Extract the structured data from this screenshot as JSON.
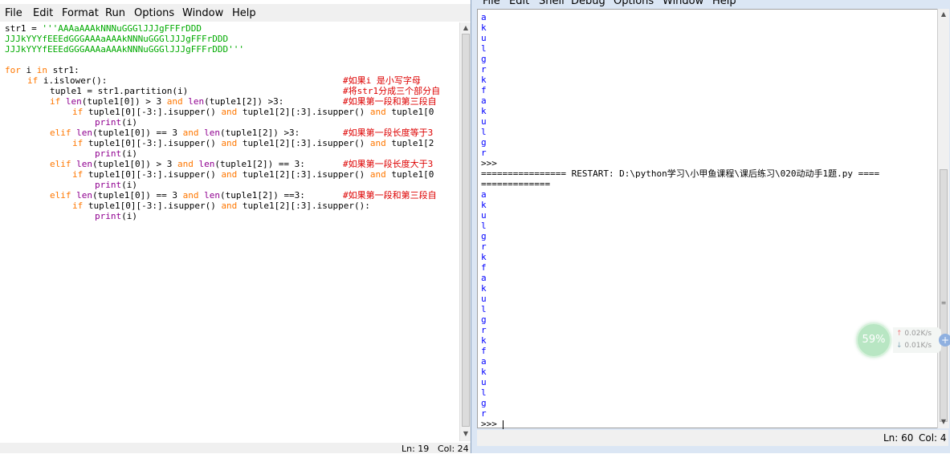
{
  "editor": {
    "menu": [
      "File",
      "Edit",
      "Format",
      "Run",
      "Options",
      "Window",
      "Help"
    ],
    "status_ln": "Ln: 19",
    "status_col": "Col: 24",
    "code": {
      "l1_a": "str1 = ",
      "l1_b": "'''AAAaAAAkNNNuGGGlJJJgFFFrDDD",
      "l2": "JJJkYYYfEEEdGGGAAAaAAAkNNNuGGGlJJJgFFFrDDD",
      "l3": "JJJkYYYfEEEdGGGAAAaAAAkNNNuGGGlJJJgFFFrDDD'''",
      "l5": [
        "for",
        " i ",
        "in",
        " str1:"
      ],
      "l6": [
        "if",
        " i.islower():"
      ],
      "l6_c": "#如果i 是小写字母",
      "l7": "tuple1 = str1.partition(i)",
      "l7_c": "#将str1分成三个部分自",
      "l8": [
        "if",
        " ",
        "len",
        "(tuple1[0]) > 3 ",
        "and",
        " ",
        "len",
        "(tuple1[2]) >3:"
      ],
      "l8_c": "#如果第一段和第三段自",
      "l9": [
        "if",
        " tuple1[0][-3:].isupper() ",
        "and",
        " tuple1[2][:3].isupper() ",
        "and",
        " tuple1[0"
      ],
      "l10": [
        "print",
        "(i)"
      ],
      "l11": [
        "elif",
        " ",
        "len",
        "(tuple1[0]) == 3 ",
        "and",
        " ",
        "len",
        "(tuple1[2]) >3:"
      ],
      "l11_c": "#如果第一段长度等于3",
      "l12": [
        "if",
        " tuple1[0][-3:].isupper() ",
        "and",
        " tuple1[2][:3].isupper() ",
        "and",
        " tuple1[2"
      ],
      "l13": [
        "print",
        "(i)"
      ],
      "l14": [
        "elif",
        " ",
        "len",
        "(tuple1[0]) > 3 ",
        "and",
        " ",
        "len",
        "(tuple1[2]) == 3:"
      ],
      "l14_c": "#如果第一段长度大于3",
      "l15": [
        "if",
        " tuple1[0][-3:].isupper() ",
        "and",
        " tuple1[2][:3].isupper() ",
        "and",
        " tuple1[0"
      ],
      "l16": [
        "print",
        "(i)"
      ],
      "l17": [
        "elif",
        " ",
        "len",
        "(tuple1[0]) == 3 ",
        "and",
        " ",
        "len",
        "(tuple1[2]) ==3:"
      ],
      "l17_c": "#如果第一段和第三段自",
      "l18": [
        "if",
        " tuple1[0][-3:].isupper() ",
        "and",
        " tuple1[2][:3].isupper():"
      ],
      "l19": [
        "print",
        "(i)"
      ]
    }
  },
  "shell": {
    "menu": [
      "File",
      "Edit",
      "Shell",
      "Debug",
      "Options",
      "Window",
      "Help"
    ],
    "output_block1": "a\nk\nu\nl\ng\nr\nk\nf\na\nk\nu\nl\ng\nr",
    "prompt": ">>>",
    "restart_line": "================ RESTART: D:\\python学习\\小甲鱼课程\\课后练习\\020动动手1题.py ====",
    "restart_line2": "=============",
    "output_block2": "a\nk\nu\nl\ng\nr\nk\nf\na\nk\nu\nl\ng\nr\nk\nf\na\nk\nu\nl\ng\nr",
    "prompt_last": ">>> ",
    "status_ln": "Ln: 60",
    "status_col": "Col: 4"
  },
  "net_widget": {
    "percent": "59%",
    "up": "0.02K/s",
    "down": "0.01K/s",
    "up_arrow": "↑",
    "down_arrow": "↓",
    "plus": "+"
  },
  "colors": {
    "keyword": "#ff7700",
    "builtin": "#900090",
    "string": "#00aa00",
    "comment": "#dd0000",
    "shell_output": "#0000ff"
  }
}
